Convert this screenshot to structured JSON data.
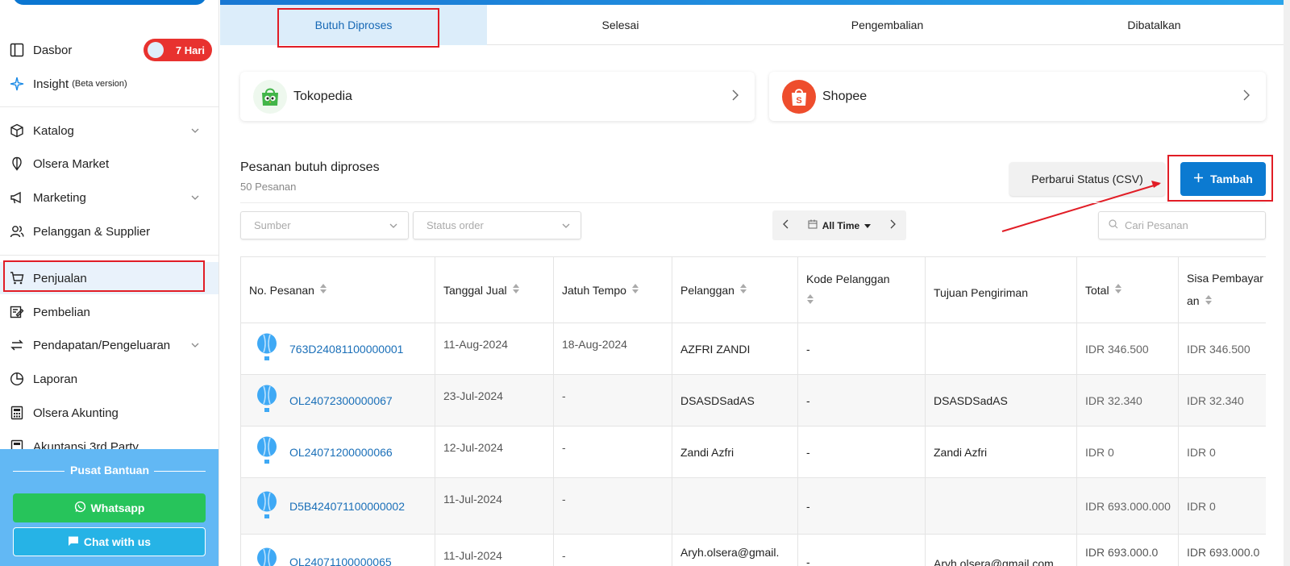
{
  "sidebar": {
    "items": [
      {
        "label": "Dasbor",
        "icon": "dashboard-icon"
      },
      {
        "label": "Insight",
        "suffix": "(Beta version)",
        "icon": "sparkle-icon"
      },
      {
        "label": "Katalog",
        "icon": "box-icon"
      },
      {
        "label": "Olsera Market",
        "icon": "market-icon"
      },
      {
        "label": "Marketing",
        "icon": "megaphone-icon"
      },
      {
        "label": "Pelanggan & Supplier",
        "icon": "users-icon"
      },
      {
        "label": "Penjualan",
        "icon": "cart-icon"
      },
      {
        "label": "Pembelian",
        "icon": "purchase-icon"
      },
      {
        "label": "Pendapatan/Pengeluaran",
        "icon": "transfer-icon"
      },
      {
        "label": "Laporan",
        "icon": "report-icon"
      },
      {
        "label": "Olsera Akunting",
        "icon": "calculator-icon"
      },
      {
        "label": "Akuntansi 3rd Party",
        "icon": "calculator-icon"
      }
    ],
    "trial_badge": "7 Hari",
    "help": {
      "title": "Pusat Bantuan",
      "whatsapp": "Whatsapp",
      "chat": "Chat with us"
    }
  },
  "tabs": [
    "Butuh Diproses",
    "Selesai",
    "Pengembalian",
    "Dibatalkan"
  ],
  "marketplaces": [
    {
      "name": "Tokopedia",
      "color": "#42b549"
    },
    {
      "name": "Shopee",
      "color": "#ee4d2d"
    }
  ],
  "section": {
    "title": "Pesanan butuh diproses",
    "count": "50 Pesanan"
  },
  "buttons": {
    "csv": "Perbarui Status (CSV)",
    "add": "Tambah"
  },
  "filters": {
    "source": "Sumber",
    "status": "Status order",
    "date": "All Time",
    "search_placeholder": "Cari Pesanan"
  },
  "table": {
    "headers": [
      "No. Pesanan",
      "Tanggal Jual",
      "Jatuh Tempo",
      "Pelanggan",
      "Kode Pelanggan",
      "Tujuan Pengiriman",
      "Total",
      "Sisa Pembayaran"
    ],
    "rows": [
      {
        "no": "763D24081100000001",
        "tgl": "11-Aug-2024",
        "tempo": "18-Aug-2024",
        "pelanggan": "AZFRI ZANDI",
        "kode": "-",
        "tujuan": "",
        "total": "IDR 346.500",
        "sisa": "IDR 346.500"
      },
      {
        "no": "OL24072300000067",
        "tgl": "23-Jul-2024",
        "tempo": "-",
        "pelanggan": "DSASDSadAS",
        "kode": "-",
        "tujuan": "DSASDSadAS",
        "total": "IDR 32.340",
        "sisa": "IDR 32.340"
      },
      {
        "no": "OL24071200000066",
        "tgl": "12-Jul-2024",
        "tempo": "-",
        "pelanggan": "Zandi Azfri",
        "kode": "-",
        "tujuan": "Zandi Azfri",
        "total": "IDR 0",
        "sisa": "IDR 0"
      },
      {
        "no": "D5B424071100000002",
        "tgl": "11-Jul-2024",
        "tempo": "-",
        "pelanggan": "",
        "kode": "-",
        "tujuan": "",
        "total": "IDR 693.000.000",
        "sisa": "IDR 0"
      },
      {
        "no": "OL24071100000065",
        "tgl": "11-Jul-2024",
        "tempo": "-",
        "pelanggan": "Aryh.olsera@gmail.",
        "kode": "-",
        "tujuan": "Aryh.olsera@gmail.com",
        "total": "IDR 693.000.0",
        "sisa": "IDR 693.000.0"
      }
    ]
  },
  "colors": {
    "accent": "#0b7ad1",
    "highlight": "#e11d26",
    "help_bg": "#62b8f4"
  }
}
